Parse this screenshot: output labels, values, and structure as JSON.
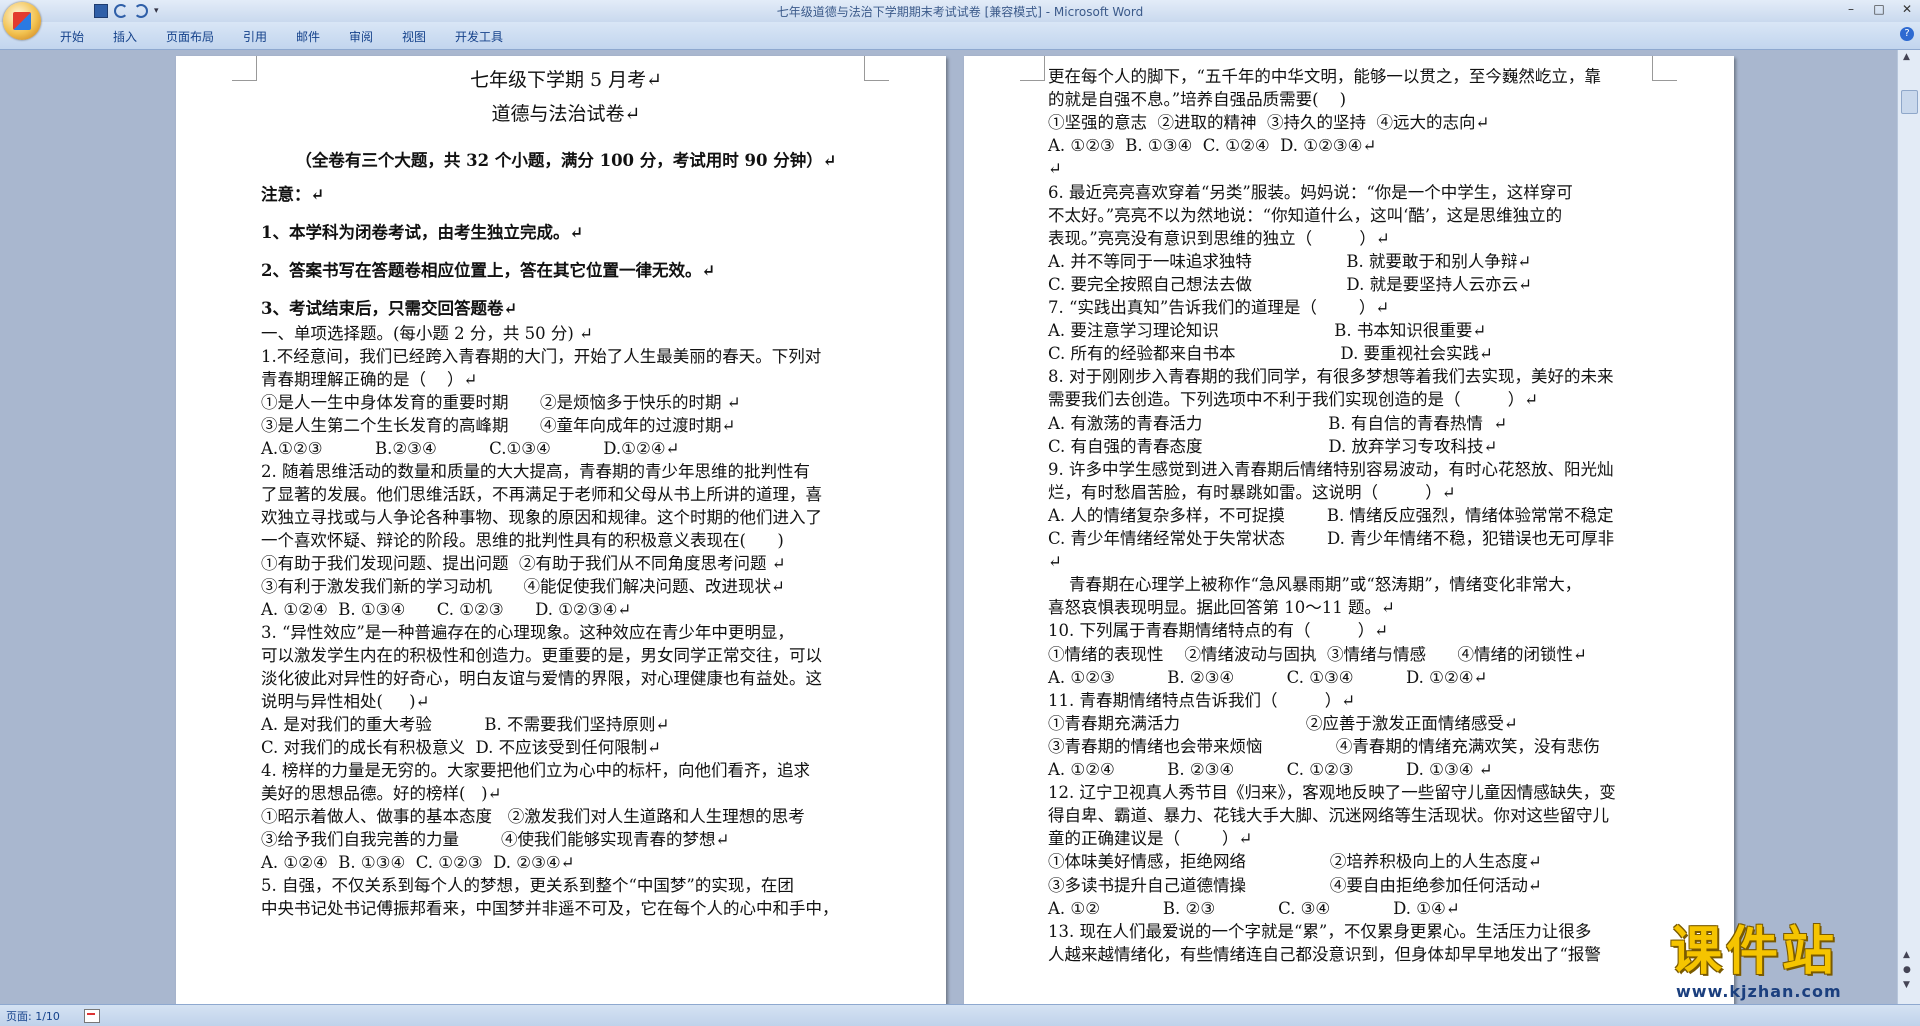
{
  "window": {
    "title": "七年级道德与法治下学期期末考试试卷 [兼容模式] - Microsoft Word",
    "controls": [
      "–",
      "□",
      "✕"
    ]
  },
  "ribbon": {
    "tabs": [
      "开始",
      "插入",
      "页面布局",
      "引用",
      "邮件",
      "审阅",
      "视图",
      "开发工具"
    ],
    "help": "?"
  },
  "status": {
    "page": "页面: 1/10"
  },
  "watermark": {
    "logo_text": "课件站",
    "url": "www.kjzhan.com"
  },
  "page1": {
    "lines": [
      "七年级下学期 5 月考↵",
      "道德与法治试卷↵",
      "（全卷有三个大题，共 32 个小题，满分 100 分，考试用时 90 分钟）↵",
      "注意：↵",
      "1、本学科为闭卷考试，由考生独立完成。↵",
      "2、答案书写在答题卷相应位置上，答在其它位置一律无效。↵",
      "3、考试结束后，只需交回答题卷↵",
      "一、单项选择题。(每小题 2 分，共 50 分) ↵",
      "1.不经意间，我们已经跨入青春期的大门，开始了人生最美丽的春天。下列对",
      "青春期理解正确的是（    ）↵",
      "①是人一生中身体发育的重要时期      ②是烦恼多于快乐的时期 ↵",
      "③是人生第二个生长发育的高峰期      ④童年向成年的过渡时期↵",
      "A.①②③          B.②③④          C.①③④          D.①②④↵",
      "2. 随着思维活动的数量和质量的大大提高，青春期的青少年思维的批判性有",
      "了显著的发展。他们思维活跃，不再满足于老师和父母从书上所讲的道理，喜",
      "欢独立寻找或与人争论各种事物、现象的原因和规律。这个时期的他们进入了",
      "一个喜欢怀疑、辩论的阶段。思维的批判性具有的积极意义表现在(      )",
      "①有助于我们发现问题、提出问题  ②有助于我们从不同角度思考问题 ↵",
      "③有利于激发我们新的学习动机      ④能促使我们解决问题、改进现状↵",
      "A. ①②④  B. ①③④      C. ①②③      D. ①②③④↵",
      "3. “异性效应”是一种普遍存在的心理现象。这种效应在青少年中更明显，",
      "可以激发学生内在的积极性和创造力。更重要的是，男女同学正常交往，可以",
      "淡化彼此对异性的好奇心，明白友谊与爱情的界限，对心理健康也有益处。这",
      "说明与异性相处(     )↵",
      "A. 是对我们的重大考验          B. 不需要我们坚持原则↵",
      "C. 对我们的成长有积极意义  D. 不应该受到任何限制↵",
      "4. 榜样的力量是无穷的。大家要把他们立为心中的标杆，向他们看齐，追求",
      "美好的思想品德。好的榜样(   )↵",
      "①昭示着做人、做事的基本态度   ②激发我们对人生道路和人生理想的思考",
      "③给予我们自我完善的力量        ④使我们能够实现青春的梦想↵",
      "A. ①②④  B. ①③④  C. ①②③  D. ②③④↵",
      "5. 自强，不仅关系到每个人的梦想，更关系到整个“中国梦”的实现，在团",
      "中央书记处书记傅振邦看来，中国梦并非遥不可及，它在每个人的心中和手中，"
    ]
  },
  "page2": {
    "lines": [
      "更在每个人的脚下，“五千年的中华文明，能够一以贯之，至今巍然屹立，靠",
      "的就是自强不息。”培养自强品质需要(    )",
      "①坚强的意志  ②进取的精神  ③持久的坚持  ④远大的志向↵",
      "A. ①②③  B. ①③④  C. ①②④  D. ①②③④↵",
      "↵",
      "6. 最近亮亮喜欢穿着“另类”服装。妈妈说：“你是一个中学生，这样穿可",
      "不太好。”亮亮不以为然地说：“你知道什么，这叫‘酷’，这是思维独立的",
      "表现。”亮亮没有意识到思维的独立（         ）↵",
      "A. 并不等同于一味追求独特                  B. 就要敢于和别人争辩↵",
      "C. 要完全按照自己想法去做                  D. 就是要坚持人云亦云↵",
      "7. “实践出真知”告诉我们的道理是（        ）↵",
      "A. 要注意学习理论知识                      B. 书本知识很重要↵",
      "C. 所有的经验都来自书本                    D. 要重视社会实践↵",
      "8. 对于刚刚步入青春期的我们同学，有很多梦想等着我们去实现，美好的未来",
      "需要我们去创造。下列选项中不利于我们实现创造的是（         ）↵",
      "A. 有激荡的青春活力                        B. 有自信的青春热情  ↵",
      "C. 有自强的青春态度                        D. 放弃学习专攻科技↵",
      "9. 许多中学生感觉到进入青春期后情绪特别容易波动，有时心花怒放、阳光灿",
      "烂，有时愁眉苦脸，有时暴跳如雷。这说明（         ）↵",
      "A. 人的情绪复杂多样，不可捉摸        B. 情绪反应强烈，情绪体验常常不稳定",
      "C. 青少年情绪经常处于失常状态        D. 青少年情绪不稳，犯错误也无可厚非",
      "↵",
      "    青春期在心理学上被称作“急风暴雨期”或“怒涛期”，情绪变化非常大，",
      "喜怒哀惧表现明显。据此回答第 10～11 题。↵",
      "10. 下列属于青春期情绪特点的有（         ）↵",
      "①情绪的表现性    ②情绪波动与固执  ③情绪与情感      ④情绪的闭锁性↵",
      "A. ①②③          B. ②③④          C. ①③④          D. ①②④↵",
      "11. 青春期情绪特点告诉我们（         ）↵",
      "①青春期充满活力                        ②应善于激发正面情绪感受↵",
      "③青春期的情绪也会带来烦恼              ④青春期的情绪充满欢笑，没有悲伤",
      "A. ①②④          B. ②③④          C. ①②③          D. ①③④ ↵",
      "12. 辽宁卫视真人秀节目《归来》，客观地反映了一些留守儿童因情感缺失，变",
      "得自卑、霸道、暴力、花钱大手大脚、沉迷网络等生活现状。你对这些留守儿",
      "童的正确建议是（        ）↵",
      "①体味美好情感，拒绝网络                ②培养积极向上的人生态度↵",
      "③多读书提升自己道德情操                ④要自由拒绝参加任何活动↵",
      "A. ①②            B. ②③            C. ③④            D. ①④↵",
      "13. 现在人们最爱说的一个字就是“累”，不仅累身更累心。生活压力让很多",
      "人越来越情绪化，有些情绪连自己都没意识到，但身体却早早地发出了“报警"
    ]
  }
}
